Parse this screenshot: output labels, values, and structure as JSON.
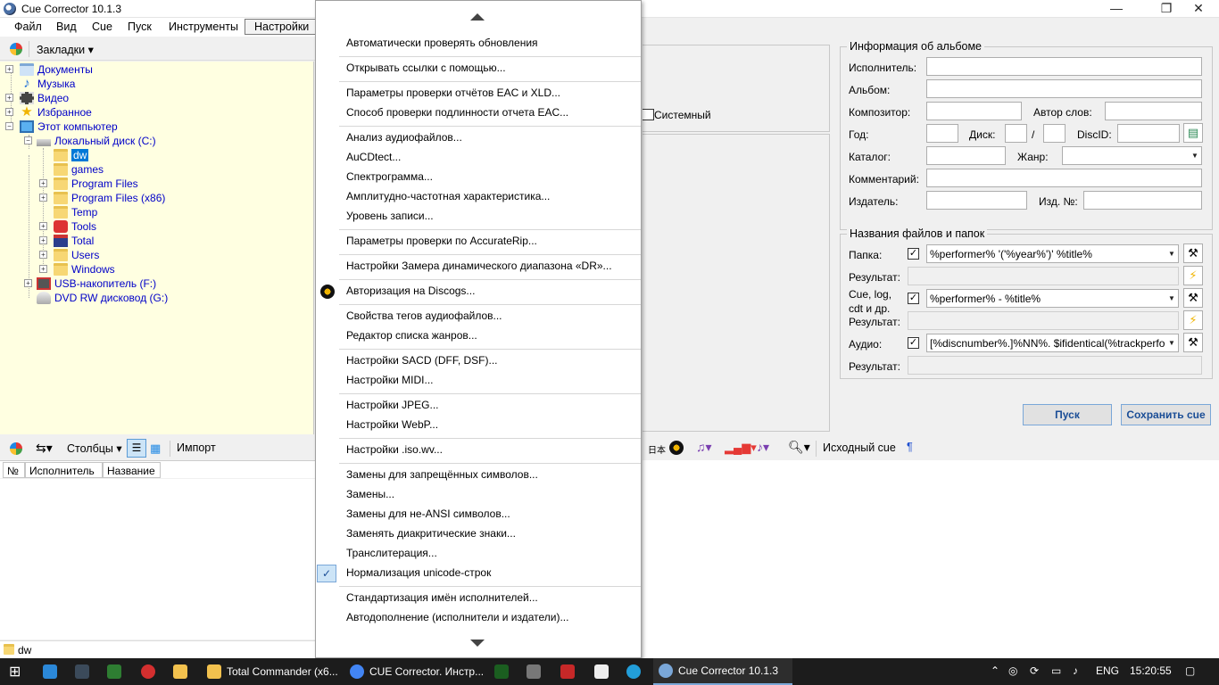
{
  "window": {
    "title": "Cue Corrector 10.1.3",
    "min": "—",
    "max": "❐",
    "close": "✕"
  },
  "menubar": [
    "Файл",
    "Вид",
    "Cue",
    "Пуск",
    "Инструменты",
    "Настройки"
  ],
  "left_toolbar": {
    "bookmarks": "Закладки ▾"
  },
  "tree": {
    "nodes": [
      {
        "label": "Документы",
        "level": 0,
        "icon": "documents-folder-icon",
        "expand": "+"
      },
      {
        "label": "Музыка",
        "level": 0,
        "icon": "music-folder-icon",
        "expand": ""
      },
      {
        "label": "Видео",
        "level": 0,
        "icon": "video-folder-icon",
        "expand": "+"
      },
      {
        "label": "Избранное",
        "level": 0,
        "icon": "star-icon",
        "expand": "+"
      },
      {
        "label": "Этот компьютер",
        "level": 0,
        "icon": "computer-icon",
        "expand": "−"
      },
      {
        "label": "Локальный диск (C:)",
        "level": 1,
        "icon": "drive-icon",
        "expand": "−"
      },
      {
        "label": "dw",
        "level": 2,
        "icon": "folder-icon",
        "expand": "",
        "selected": true
      },
      {
        "label": "games",
        "level": 2,
        "icon": "folder-icon",
        "expand": ""
      },
      {
        "label": "Program Files",
        "level": 2,
        "icon": "folder-icon",
        "expand": "+"
      },
      {
        "label": "Program Files (x86)",
        "level": 2,
        "icon": "folder-icon",
        "expand": "+"
      },
      {
        "label": "Temp",
        "level": 2,
        "icon": "folder-icon",
        "expand": ""
      },
      {
        "label": "Tools",
        "level": 2,
        "icon": "tools-icon",
        "expand": "+"
      },
      {
        "label": "Total",
        "level": 2,
        "icon": "floppy-icon",
        "expand": "+"
      },
      {
        "label": "Users",
        "level": 2,
        "icon": "folder-icon",
        "expand": "+"
      },
      {
        "label": "Windows",
        "level": 2,
        "icon": "folder-icon",
        "expand": "+"
      },
      {
        "label": "USB-накопитель (F:)",
        "level": 1,
        "icon": "usb-drive-icon",
        "expand": "+"
      },
      {
        "label": "DVD RW дисковод (G:)",
        "level": 1,
        "icon": "dvd-drive-icon",
        "expand": ""
      }
    ]
  },
  "bottom_left_toolbar": {
    "columns": "Столбцы ▾",
    "import": "Импорт"
  },
  "track_columns": [
    "№",
    "Исполнитель",
    "Название"
  ],
  "status_folder": "dw",
  "system_checkbox": "Системный",
  "album_info": {
    "title": "Информация об альбоме",
    "performer": "Исполнитель:",
    "album": "Альбом:",
    "composer": "Композитор:",
    "lyricist": "Автор слов:",
    "year": "Год:",
    "disc": "Диск:",
    "slash": "/",
    "discid": "DiscID:",
    "catalog": "Каталог:",
    "genre": "Жанр:",
    "comment": "Комментарий:",
    "publisher": "Издатель:",
    "pub_no": "Изд. №:"
  },
  "names": {
    "title": "Названия файлов и папок",
    "folder": "Папка:",
    "folder_value": "%performer% '('%year%')' %title%",
    "result": "Результат:",
    "cue_label_1": "Cue, log,",
    "cue_label_2": "cdt и др.",
    "cue_value": "%performer% - %title%",
    "audio": "Аудио:",
    "audio_value": "[%discnumber%.]%NN%. $ifidentical(%trackperfo"
  },
  "buttons": {
    "start": "Пуск",
    "save": "Сохранить cue"
  },
  "right_toolbar": {
    "source_cue": "Исходный cue",
    "pilcrow": "¶",
    "jp": "日本"
  },
  "menu": {
    "items": [
      "Автоматически проверять обновления",
      "Открывать ссылки с помощью...",
      "Параметры проверки отчётов EAC и XLD...",
      "Способ проверки подлинности отчета EAC...",
      "Анализ аудиофайлов...",
      "AuCDtect...",
      "Спектрограмма...",
      "Амплитудно-частотная характеристика...",
      "Уровень записи...",
      "Параметры проверки по AccurateRip...",
      "Настройки Замера динамического диапазона «DR»...",
      "Авторизация на Discogs...",
      "Свойства тегов аудиофайлов...",
      "Редактор списка жанров...",
      "Настройки SACD (DFF, DSF)...",
      "Настройки MIDI...",
      "Настройки JPEG...",
      "Настройки WebP...",
      "Настройки .iso.wv...",
      "Замены для запрещённых символов...",
      "Замены...",
      "Замены для не-ANSI символов...",
      "Заменять диакритические знаки...",
      "Транслитерация...",
      "Нормализация unicode-строк",
      "Стандартизация имён исполнителей...",
      "Автодополнение (исполнители и издатели)..."
    ]
  },
  "taskbar": {
    "apps": [
      {
        "label": "Total Commander (x6...",
        "color": "#f2c14e"
      },
      {
        "label": "CUE Corrector. Инстр...",
        "color": "#4285f4"
      },
      {
        "label": "Cue Corrector 10.1.3",
        "color": "#7aa7d8"
      }
    ],
    "lang": "ENG",
    "time": "15:20:55"
  }
}
